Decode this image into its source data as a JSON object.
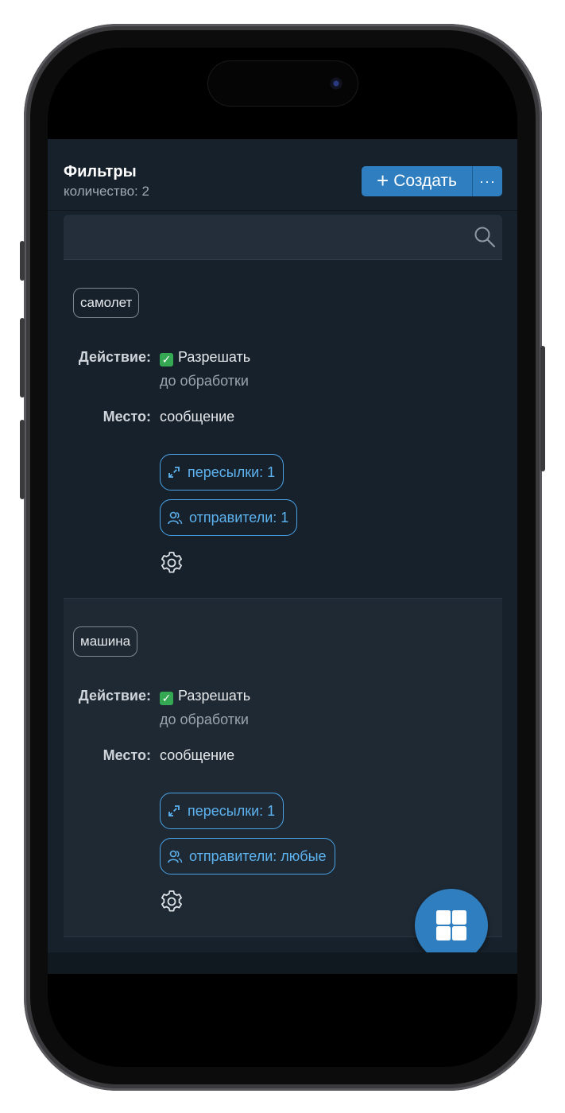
{
  "header": {
    "title": "Фильтры",
    "count_text": "количество: 2",
    "create_label": "Создать",
    "more_label": "···"
  },
  "search": {
    "placeholder": ""
  },
  "filters": [
    {
      "keyword": "самолет",
      "action_label": "Действие:",
      "action_value": "Разрешать",
      "action_detail": "до обработки",
      "place_label": "Место:",
      "place_value": "сообщение",
      "forwards_label": "пересылки: 1",
      "senders_label": "отправители: 1"
    },
    {
      "keyword": "машина",
      "action_label": "Действие:",
      "action_value": "Разрешать",
      "action_detail": "до обработки",
      "place_label": "Место:",
      "place_value": "сообщение",
      "forwards_label": "пересылки: 1",
      "senders_label": "отправители: любые"
    }
  ],
  "colors": {
    "background": "#17212b",
    "accent": "#2f7fc0",
    "link": "#5db3f0",
    "check": "#35a853"
  },
  "icons": [
    "plus-icon",
    "more-icon",
    "search-icon",
    "check-icon",
    "forward-arrows-icon",
    "users-icon",
    "gear-icon",
    "grid-icon"
  ]
}
